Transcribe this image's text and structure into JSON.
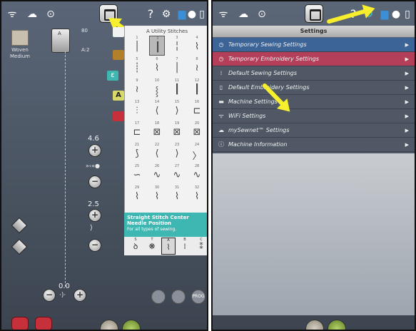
{
  "left_screen": {
    "fabric": {
      "label": "Woven Medium"
    },
    "presser_foot": {
      "label": "A",
      "scale_top": "80",
      "scale_side": "A:2"
    },
    "stitch_width": {
      "value": "4.6"
    },
    "stitch_length": {
      "value": "2.5"
    },
    "needle_position": {
      "value": "0.0"
    },
    "prog_label": "PROG",
    "stitch_menu": {
      "title": "A Utility Stitches",
      "numbers": [
        "1",
        "2",
        "3",
        "4",
        "5",
        "6",
        "7",
        "8",
        "9",
        "10",
        "11",
        "12",
        "13",
        "14",
        "15",
        "16",
        "17",
        "18",
        "19",
        "20",
        "21",
        "22",
        "23",
        "24",
        "25",
        "26",
        "27",
        "28",
        "29",
        "30",
        "31",
        "32"
      ],
      "selected_index": 1,
      "stitch_name": "Straight Stitch Center Needle Position",
      "stitch_desc": "For all types of sewing.",
      "categories": [
        {
          "code": "S",
          "icon": "ꝺ"
        },
        {
          "code": "T",
          "icon": "❋"
        },
        {
          "code": "A",
          "icon": "⌇"
        },
        {
          "code": "B",
          "icon": "⁞"
        },
        {
          "code": "C",
          "icon": "⁑"
        }
      ]
    }
  },
  "right_screen": {
    "header": "Settings",
    "items": [
      {
        "label": "Temporary Sewing Settings",
        "icon": "◷",
        "style": "blue"
      },
      {
        "label": "Temporary Embroidery Settings",
        "icon": "◷",
        "style": "red"
      },
      {
        "label": "Default Sewing Settings",
        "icon": "⁞",
        "style": "dark"
      },
      {
        "label": "Default Embroidery Settings",
        "icon": "▯",
        "style": "dark"
      },
      {
        "label": "Machine Settings",
        "icon": "▬",
        "style": "dark"
      },
      {
        "label": "WiFi Settings",
        "icon": "ᯤ",
        "style": "dark"
      },
      {
        "label": "mySewnet™ Settings",
        "icon": "☁",
        "style": "dark"
      },
      {
        "label": "Machine Information",
        "icon": "ⓘ",
        "style": "dark"
      }
    ],
    "chevron": "▶"
  },
  "status_bar": {
    "help": "?",
    "icons": [
      "wifi-icon",
      "cloud-icon",
      "account-icon",
      "home-icon",
      "help-icon",
      "settings-icon",
      "mode-icon",
      "toggle-icon",
      "window-icon"
    ]
  },
  "colors": {
    "highlight_yellow": "#f7ee2d",
    "row_blue": "#3d6497",
    "row_red": "#b43f5b",
    "info_teal": "#3eb6b1"
  }
}
